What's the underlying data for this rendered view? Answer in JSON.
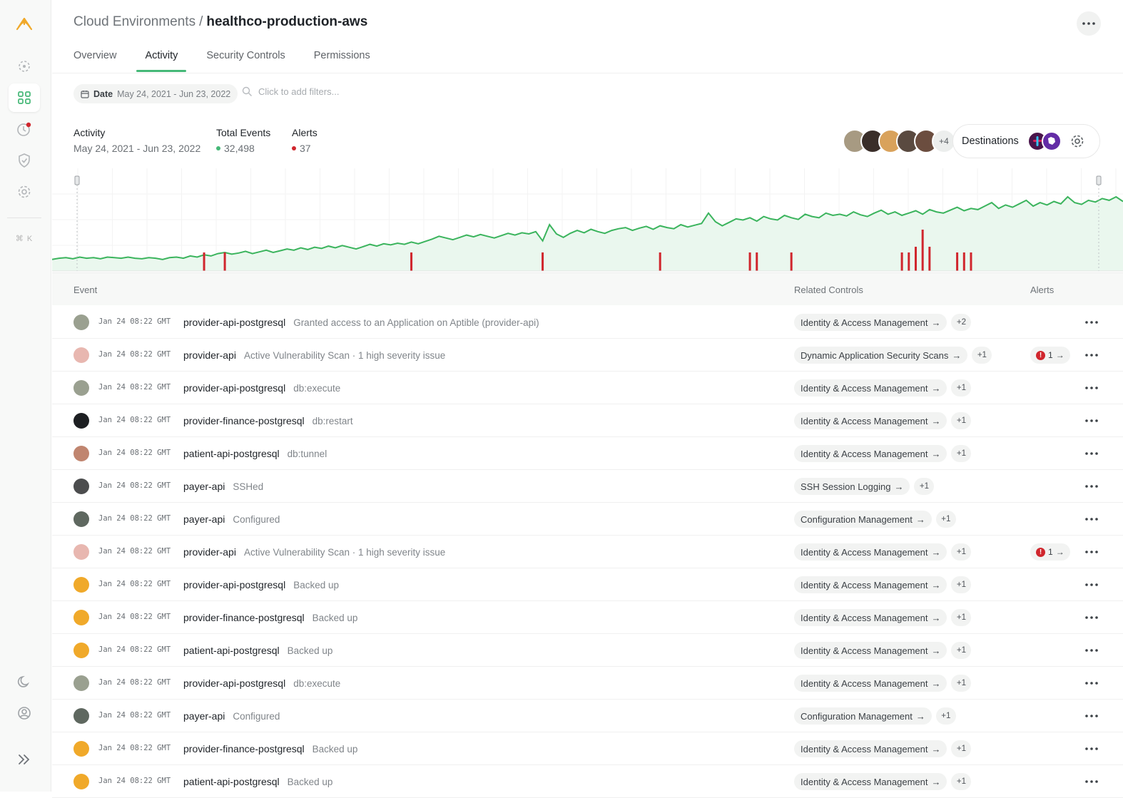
{
  "sidebar": {
    "logo": "aptible-logo-icon",
    "items": [
      {
        "name": "environments-icon"
      },
      {
        "name": "grid-icon",
        "active": true
      },
      {
        "name": "alerts-icon"
      },
      {
        "name": "shield-icon"
      },
      {
        "name": "gear-icon"
      }
    ],
    "shortcut": "⌘ K",
    "bottom": [
      "moon-icon",
      "user-icon",
      "expand-icon"
    ]
  },
  "header": {
    "breadcrumb_parent": "Cloud Environments",
    "separator": "/",
    "breadcrumb_current": "healthco-production-aws"
  },
  "tabs": [
    {
      "label": "Overview"
    },
    {
      "label": "Activity",
      "active": true
    },
    {
      "label": "Security Controls"
    },
    {
      "label": "Permissions"
    }
  ],
  "filters": {
    "date_key": "Date",
    "date_value": "May 24, 2021 - Jun 23, 2022",
    "placeholder": "Click to add filters..."
  },
  "stats": {
    "activity_label": "Activity",
    "activity_range": "May 24, 2021 - Jun 23, 2022",
    "events_label": "Total Events",
    "events_value": "32,498",
    "alerts_label": "Alerts",
    "alerts_value": "37"
  },
  "destinations": {
    "more_count": "+4",
    "label": "Destinations"
  },
  "colors": {
    "accent": "#45b877",
    "line": "#3bb45d",
    "alert": "#d0262d",
    "brand": "#f0a92a"
  },
  "chart_data": {
    "type": "area",
    "series": [
      {
        "values": [
          10,
          12,
          13,
          11,
          14,
          12,
          13,
          11,
          14,
          13,
          12,
          14,
          12,
          11,
          13,
          12,
          10,
          13,
          14,
          12,
          16,
          14,
          18,
          16,
          20,
          22,
          19,
          21,
          24,
          20,
          23,
          26,
          22,
          25,
          28,
          26,
          30,
          27,
          31,
          29,
          33,
          30,
          34,
          31,
          28,
          32,
          36,
          33,
          37,
          35,
          38,
          36,
          40,
          37,
          41,
          45,
          50,
          47,
          44,
          48,
          52,
          49,
          53,
          50,
          47,
          51,
          55,
          52,
          56,
          54,
          58,
          42,
          70,
          54,
          48,
          55,
          60,
          56,
          62,
          58,
          55,
          60,
          63,
          65,
          60,
          64,
          67,
          62,
          68,
          65,
          63,
          70,
          66,
          69,
          72,
          90,
          75,
          68,
          74,
          80,
          78,
          82,
          76,
          84,
          80,
          78,
          86,
          82,
          79,
          88,
          84,
          82,
          90,
          86,
          88,
          85,
          92,
          87,
          84,
          90,
          95,
          88,
          92,
          86,
          90,
          94,
          88,
          96,
          92,
          90,
          95,
          100,
          94,
          98,
          96,
          102,
          108,
          98,
          104,
          100,
          106,
          112,
          102,
          108,
          104,
          110,
          106,
          118,
          108,
          105,
          112,
          109,
          115,
          112,
          118,
          110
        ]
      }
    ],
    "alert_markers": [
      {
        "index": 22,
        "count": 1
      },
      {
        "index": 25,
        "count": 1
      },
      {
        "index": 52,
        "count": 1
      },
      {
        "index": 71,
        "count": 1
      },
      {
        "index": 88,
        "count": 1
      },
      {
        "index": 101,
        "count": 1
      },
      {
        "index": 102,
        "count": 1
      },
      {
        "index": 107,
        "count": 1
      },
      {
        "index": 123,
        "count": 1
      },
      {
        "index": 124,
        "count": 1
      },
      {
        "index": 125,
        "count": 2
      },
      {
        "index": 126,
        "count": 5
      },
      {
        "index": 127,
        "count": 2
      },
      {
        "index": 131,
        "count": 1
      },
      {
        "index": 132,
        "count": 1
      },
      {
        "index": 133,
        "count": 1
      }
    ],
    "grid": true
  },
  "table": {
    "columns": [
      "Event",
      "Related Controls",
      "Alerts"
    ],
    "rows": [
      {
        "avatar": "#9aa090",
        "time": "Jan 24 08:22 GMT",
        "resource": "provider-api-postgresql",
        "desc": "Granted access to an Application on Aptible (provider-api)",
        "control": "Identity & Access Management",
        "more": "+2",
        "alert": ""
      },
      {
        "avatar": "#e8b7b0",
        "time": "Jan 24 08:22 GMT",
        "resource": "provider-api",
        "desc": "Active Vulnerability Scan · 1 high severity issue",
        "control": "Dynamic Application Security Scans",
        "more": "+1",
        "alert": "1"
      },
      {
        "avatar": "#9aa090",
        "time": "Jan 24 08:22 GMT",
        "resource": "provider-api-postgresql",
        "desc": "db:execute",
        "control": "Identity & Access Management",
        "more": "+1",
        "alert": ""
      },
      {
        "avatar": "#1d1f22",
        "time": "Jan 24 08:22 GMT",
        "resource": "provider-finance-postgresql",
        "desc": "db:restart",
        "control": "Identity & Access Management",
        "more": "+1",
        "alert": ""
      },
      {
        "avatar": "#c0856f",
        "time": "Jan 24 08:22 GMT",
        "resource": "patient-api-postgresql",
        "desc": "db:tunnel",
        "control": "Identity & Access Management",
        "more": "+1",
        "alert": ""
      },
      {
        "avatar": "#4c4d4e",
        "time": "Jan 24 08:22 GMT",
        "resource": "payer-api",
        "desc": "SSHed",
        "control": "SSH Session Logging",
        "more": "+1",
        "alert": ""
      },
      {
        "avatar": "#5f6860",
        "time": "Jan 24 08:22 GMT",
        "resource": "payer-api",
        "desc": "Configured",
        "control": "Configuration Management",
        "more": "+1",
        "alert": ""
      },
      {
        "avatar": "#e8b7b0",
        "time": "Jan 24 08:22 GMT",
        "resource": "provider-api",
        "desc": "Active Vulnerability Scan · 1 high severity issue",
        "control": "Identity & Access Management",
        "more": "+1",
        "alert": "1"
      },
      {
        "avatar": "#f0a92a",
        "time": "Jan 24 08:22 GMT",
        "resource": "provider-api-postgresql",
        "desc": "Backed up",
        "control": "Identity & Access Management",
        "more": "+1",
        "alert": ""
      },
      {
        "avatar": "#f0a92a",
        "time": "Jan 24 08:22 GMT",
        "resource": "provider-finance-postgresql",
        "desc": "Backed up",
        "control": "Identity & Access Management",
        "more": "+1",
        "alert": ""
      },
      {
        "avatar": "#f0a92a",
        "time": "Jan 24 08:22 GMT",
        "resource": "patient-api-postgresql",
        "desc": "Backed up",
        "control": "Identity & Access Management",
        "more": "+1",
        "alert": ""
      },
      {
        "avatar": "#9aa090",
        "time": "Jan 24 08:22 GMT",
        "resource": "provider-api-postgresql",
        "desc": "db:execute",
        "control": "Identity & Access Management",
        "more": "+1",
        "alert": ""
      },
      {
        "avatar": "#5f6860",
        "time": "Jan 24 08:22 GMT",
        "resource": "payer-api",
        "desc": "Configured",
        "control": "Configuration Management",
        "more": "+1",
        "alert": ""
      },
      {
        "avatar": "#f0a92a",
        "time": "Jan 24 08:22 GMT",
        "resource": "provider-finance-postgresql",
        "desc": "Backed up",
        "control": "Identity & Access Management",
        "more": "+1",
        "alert": ""
      },
      {
        "avatar": "#f0a92a",
        "time": "Jan 24 08:22 GMT",
        "resource": "patient-api-postgresql",
        "desc": "Backed up",
        "control": "Identity & Access Management",
        "more": "+1",
        "alert": ""
      }
    ]
  }
}
